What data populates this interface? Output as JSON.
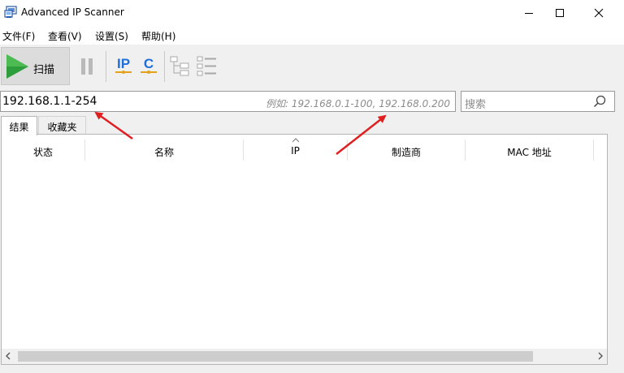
{
  "window": {
    "title": "Advanced IP Scanner",
    "controls": [
      "minimize",
      "maximize",
      "close"
    ]
  },
  "menu": {
    "items": [
      "文件(F)",
      "查看(V)",
      "设置(S)",
      "帮助(H)"
    ]
  },
  "toolbar": {
    "scan_label": "扫描",
    "buttons": [
      "play-icon",
      "pause-icon",
      "ip-icon",
      "c-icon",
      "tree-expand-icon",
      "tree-collapse-icon"
    ],
    "ip_glyph": "IP",
    "c_glyph": "C"
  },
  "range": {
    "value": "192.168.1.1-254",
    "example": "例如: 192.168.0.1-100, 192.168.0.200"
  },
  "search": {
    "placeholder": "搜索",
    "icon": "search-icon"
  },
  "tabs": [
    {
      "label": "结果",
      "active": true
    },
    {
      "label": "收藏夹",
      "active": false
    }
  ],
  "results": {
    "columns": [
      "状态",
      "名称",
      "IP",
      "制造商",
      "MAC 地址"
    ],
    "sorted_column": "IP",
    "rows": []
  },
  "colors": {
    "play_green": "#2e9e3c",
    "ip_blue": "#1e6fd9",
    "annotation_red": "#e02020"
  }
}
